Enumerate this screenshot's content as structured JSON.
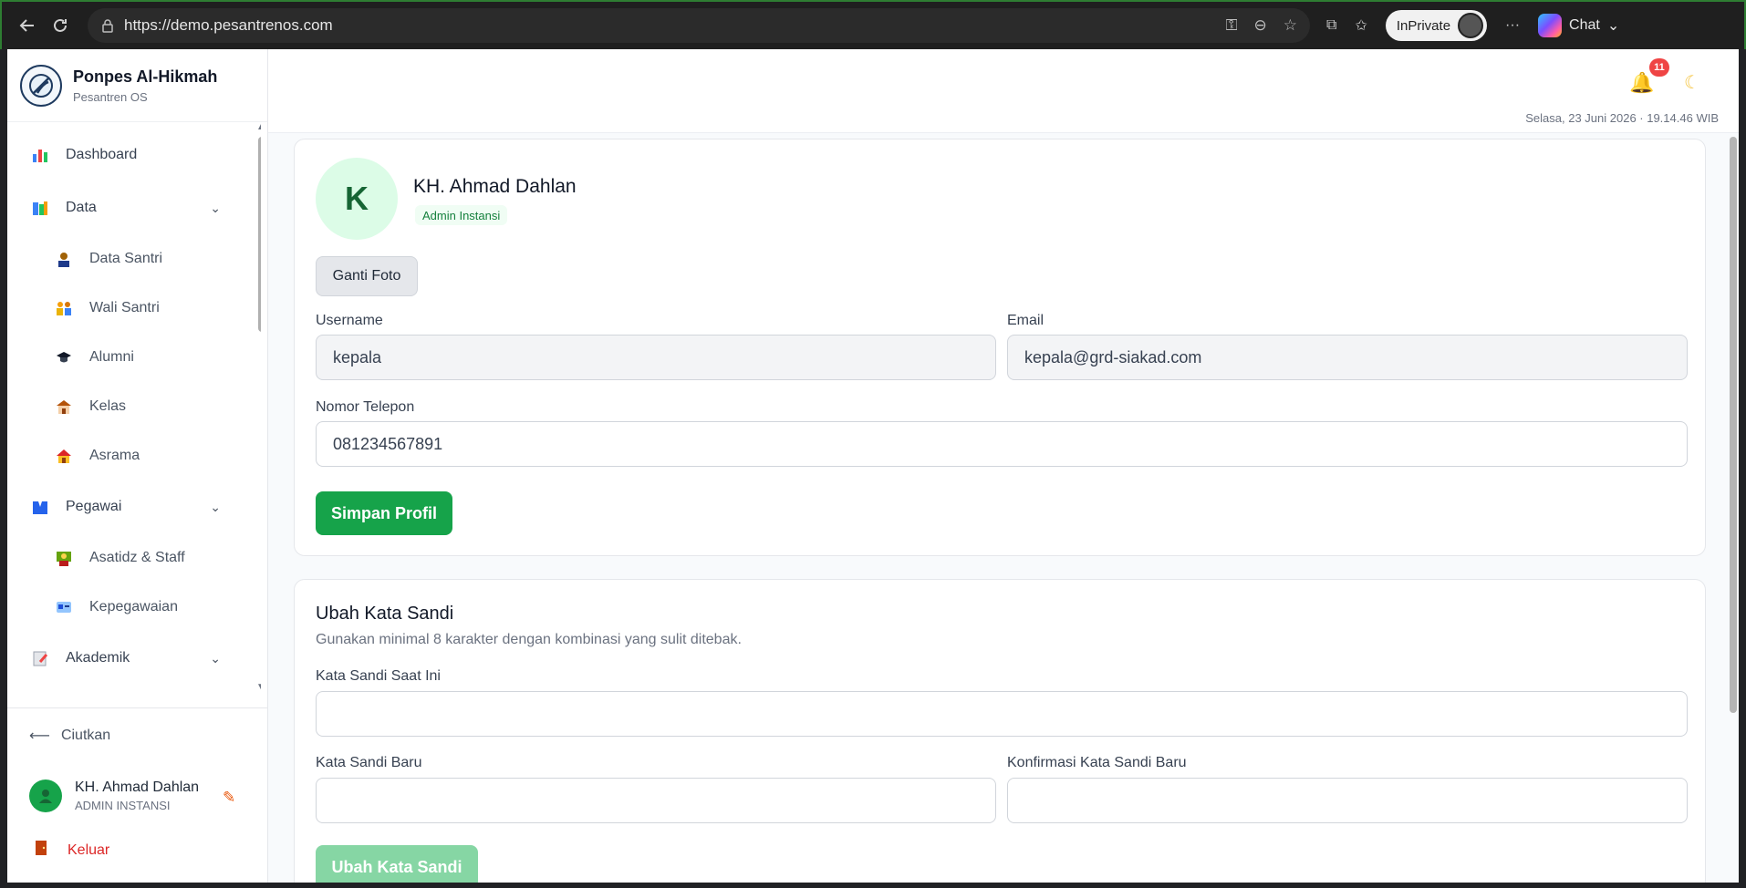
{
  "browser": {
    "url": "https://demo.pesantrenos.com",
    "inprivate_label": "InPrivate",
    "chat_label": "Chat"
  },
  "sidebar": {
    "brand_name": "Ponpes Al-Hikmah",
    "brand_sub": "Pesantren OS",
    "items": [
      {
        "label": "Dashboard",
        "icon": "dashboard-chart-icon"
      },
      {
        "label": "Data",
        "icon": "books-icon"
      },
      {
        "label": "Data Santri",
        "icon": "student-icon"
      },
      {
        "label": "Wali Santri",
        "icon": "family-icon"
      },
      {
        "label": "Alumni",
        "icon": "graduation-cap-icon"
      },
      {
        "label": "Kelas",
        "icon": "school-building-icon"
      },
      {
        "label": "Asrama",
        "icon": "house-icon"
      },
      {
        "label": "Pegawai",
        "icon": "employees-icon"
      },
      {
        "label": "Asatidz & Staff",
        "icon": "teacher-icon"
      },
      {
        "label": "Kepegawaian",
        "icon": "id-card-icon"
      },
      {
        "label": "Akademik",
        "icon": "notepad-icon"
      }
    ],
    "collapse_label": "Ciutkan",
    "user_name": "KH. Ahmad Dahlan",
    "user_role": "ADMIN INSTANSI",
    "logout_label": "Keluar"
  },
  "topbar": {
    "notification_count": "11",
    "datetime": "Selasa, 23 Juni 2026 · 19.14.46 WIB"
  },
  "profile": {
    "avatar_initial": "K",
    "name": "KH. Ahmad Dahlan",
    "role": "Admin Instansi",
    "change_photo_label": "Ganti Foto",
    "username_label": "Username",
    "username_value": "kepala",
    "email_label": "Email",
    "email_value": "kepala@grd-siakad.com",
    "phone_label": "Nomor Telepon",
    "phone_value": "081234567891",
    "save_label": "Simpan Profil"
  },
  "password": {
    "title": "Ubah Kata Sandi",
    "description": "Gunakan minimal 8 karakter dengan kombinasi yang sulit ditebak.",
    "current_label": "Kata Sandi Saat Ini",
    "new_label": "Kata Sandi Baru",
    "confirm_label": "Konfirmasi Kata Sandi Baru",
    "submit_label": "Ubah Kata Sandi"
  },
  "colors": {
    "primary": "#16a34a",
    "primary_disabled": "#86d6a4",
    "badge_red": "#ef4444",
    "logout_red": "#dc2626"
  }
}
